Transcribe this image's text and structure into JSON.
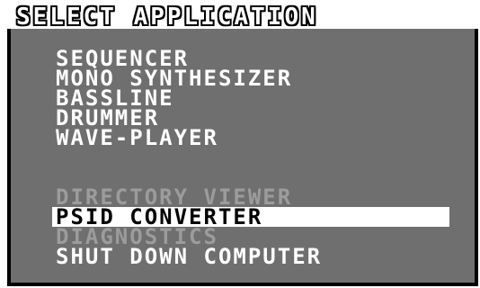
{
  "title": "SELECT APPLICATION",
  "menu": {
    "group1": [
      "SEQUENCER",
      "MONO SYNTHESIZER",
      "BASSLINE",
      "DRUMMER",
      "WAVE-PLAYER"
    ],
    "group2": [
      "DIRECTORY VIEWER",
      "PSID CONVERTER",
      "DIAGNOSTICS",
      "SHUT DOWN COMPUTER"
    ]
  },
  "colors": {
    "background": "#6f6f6f",
    "text": "#ffffff",
    "dim_text": "#9c9c9c",
    "selection_background": "#ffffff",
    "selection_text": "#000000",
    "frame": "#000000"
  }
}
